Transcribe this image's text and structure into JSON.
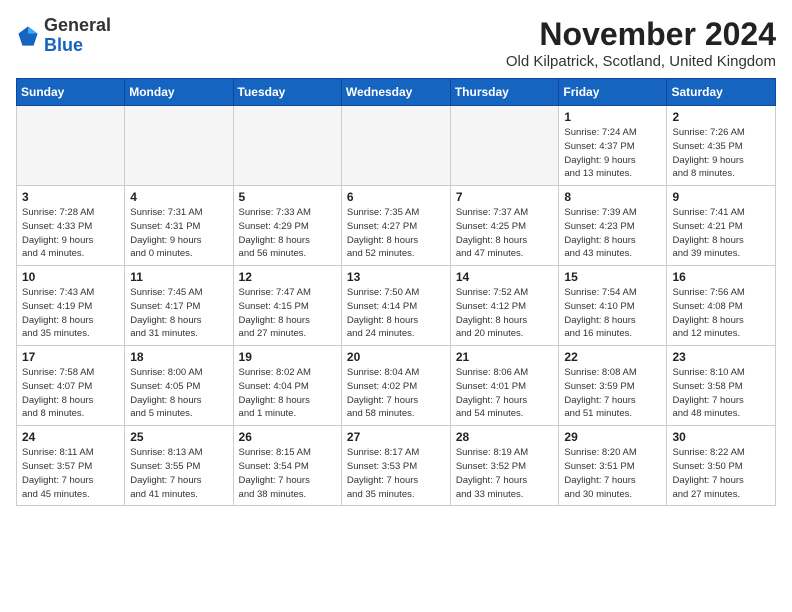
{
  "logo": {
    "general": "General",
    "blue": "Blue"
  },
  "header": {
    "month": "November 2024",
    "location": "Old Kilpatrick, Scotland, United Kingdom"
  },
  "weekdays": [
    "Sunday",
    "Monday",
    "Tuesday",
    "Wednesday",
    "Thursday",
    "Friday",
    "Saturday"
  ],
  "weeks": [
    [
      {
        "day": "",
        "info": ""
      },
      {
        "day": "",
        "info": ""
      },
      {
        "day": "",
        "info": ""
      },
      {
        "day": "",
        "info": ""
      },
      {
        "day": "",
        "info": ""
      },
      {
        "day": "1",
        "info": "Sunrise: 7:24 AM\nSunset: 4:37 PM\nDaylight: 9 hours\nand 13 minutes."
      },
      {
        "day": "2",
        "info": "Sunrise: 7:26 AM\nSunset: 4:35 PM\nDaylight: 9 hours\nand 8 minutes."
      }
    ],
    [
      {
        "day": "3",
        "info": "Sunrise: 7:28 AM\nSunset: 4:33 PM\nDaylight: 9 hours\nand 4 minutes."
      },
      {
        "day": "4",
        "info": "Sunrise: 7:31 AM\nSunset: 4:31 PM\nDaylight: 9 hours\nand 0 minutes."
      },
      {
        "day": "5",
        "info": "Sunrise: 7:33 AM\nSunset: 4:29 PM\nDaylight: 8 hours\nand 56 minutes."
      },
      {
        "day": "6",
        "info": "Sunrise: 7:35 AM\nSunset: 4:27 PM\nDaylight: 8 hours\nand 52 minutes."
      },
      {
        "day": "7",
        "info": "Sunrise: 7:37 AM\nSunset: 4:25 PM\nDaylight: 8 hours\nand 47 minutes."
      },
      {
        "day": "8",
        "info": "Sunrise: 7:39 AM\nSunset: 4:23 PM\nDaylight: 8 hours\nand 43 minutes."
      },
      {
        "day": "9",
        "info": "Sunrise: 7:41 AM\nSunset: 4:21 PM\nDaylight: 8 hours\nand 39 minutes."
      }
    ],
    [
      {
        "day": "10",
        "info": "Sunrise: 7:43 AM\nSunset: 4:19 PM\nDaylight: 8 hours\nand 35 minutes."
      },
      {
        "day": "11",
        "info": "Sunrise: 7:45 AM\nSunset: 4:17 PM\nDaylight: 8 hours\nand 31 minutes."
      },
      {
        "day": "12",
        "info": "Sunrise: 7:47 AM\nSunset: 4:15 PM\nDaylight: 8 hours\nand 27 minutes."
      },
      {
        "day": "13",
        "info": "Sunrise: 7:50 AM\nSunset: 4:14 PM\nDaylight: 8 hours\nand 24 minutes."
      },
      {
        "day": "14",
        "info": "Sunrise: 7:52 AM\nSunset: 4:12 PM\nDaylight: 8 hours\nand 20 minutes."
      },
      {
        "day": "15",
        "info": "Sunrise: 7:54 AM\nSunset: 4:10 PM\nDaylight: 8 hours\nand 16 minutes."
      },
      {
        "day": "16",
        "info": "Sunrise: 7:56 AM\nSunset: 4:08 PM\nDaylight: 8 hours\nand 12 minutes."
      }
    ],
    [
      {
        "day": "17",
        "info": "Sunrise: 7:58 AM\nSunset: 4:07 PM\nDaylight: 8 hours\nand 8 minutes."
      },
      {
        "day": "18",
        "info": "Sunrise: 8:00 AM\nSunset: 4:05 PM\nDaylight: 8 hours\nand 5 minutes."
      },
      {
        "day": "19",
        "info": "Sunrise: 8:02 AM\nSunset: 4:04 PM\nDaylight: 8 hours\nand 1 minute."
      },
      {
        "day": "20",
        "info": "Sunrise: 8:04 AM\nSunset: 4:02 PM\nDaylight: 7 hours\nand 58 minutes."
      },
      {
        "day": "21",
        "info": "Sunrise: 8:06 AM\nSunset: 4:01 PM\nDaylight: 7 hours\nand 54 minutes."
      },
      {
        "day": "22",
        "info": "Sunrise: 8:08 AM\nSunset: 3:59 PM\nDaylight: 7 hours\nand 51 minutes."
      },
      {
        "day": "23",
        "info": "Sunrise: 8:10 AM\nSunset: 3:58 PM\nDaylight: 7 hours\nand 48 minutes."
      }
    ],
    [
      {
        "day": "24",
        "info": "Sunrise: 8:11 AM\nSunset: 3:57 PM\nDaylight: 7 hours\nand 45 minutes."
      },
      {
        "day": "25",
        "info": "Sunrise: 8:13 AM\nSunset: 3:55 PM\nDaylight: 7 hours\nand 41 minutes."
      },
      {
        "day": "26",
        "info": "Sunrise: 8:15 AM\nSunset: 3:54 PM\nDaylight: 7 hours\nand 38 minutes."
      },
      {
        "day": "27",
        "info": "Sunrise: 8:17 AM\nSunset: 3:53 PM\nDaylight: 7 hours\nand 35 minutes."
      },
      {
        "day": "28",
        "info": "Sunrise: 8:19 AM\nSunset: 3:52 PM\nDaylight: 7 hours\nand 33 minutes."
      },
      {
        "day": "29",
        "info": "Sunrise: 8:20 AM\nSunset: 3:51 PM\nDaylight: 7 hours\nand 30 minutes."
      },
      {
        "day": "30",
        "info": "Sunrise: 8:22 AM\nSunset: 3:50 PM\nDaylight: 7 hours\nand 27 minutes."
      }
    ]
  ]
}
